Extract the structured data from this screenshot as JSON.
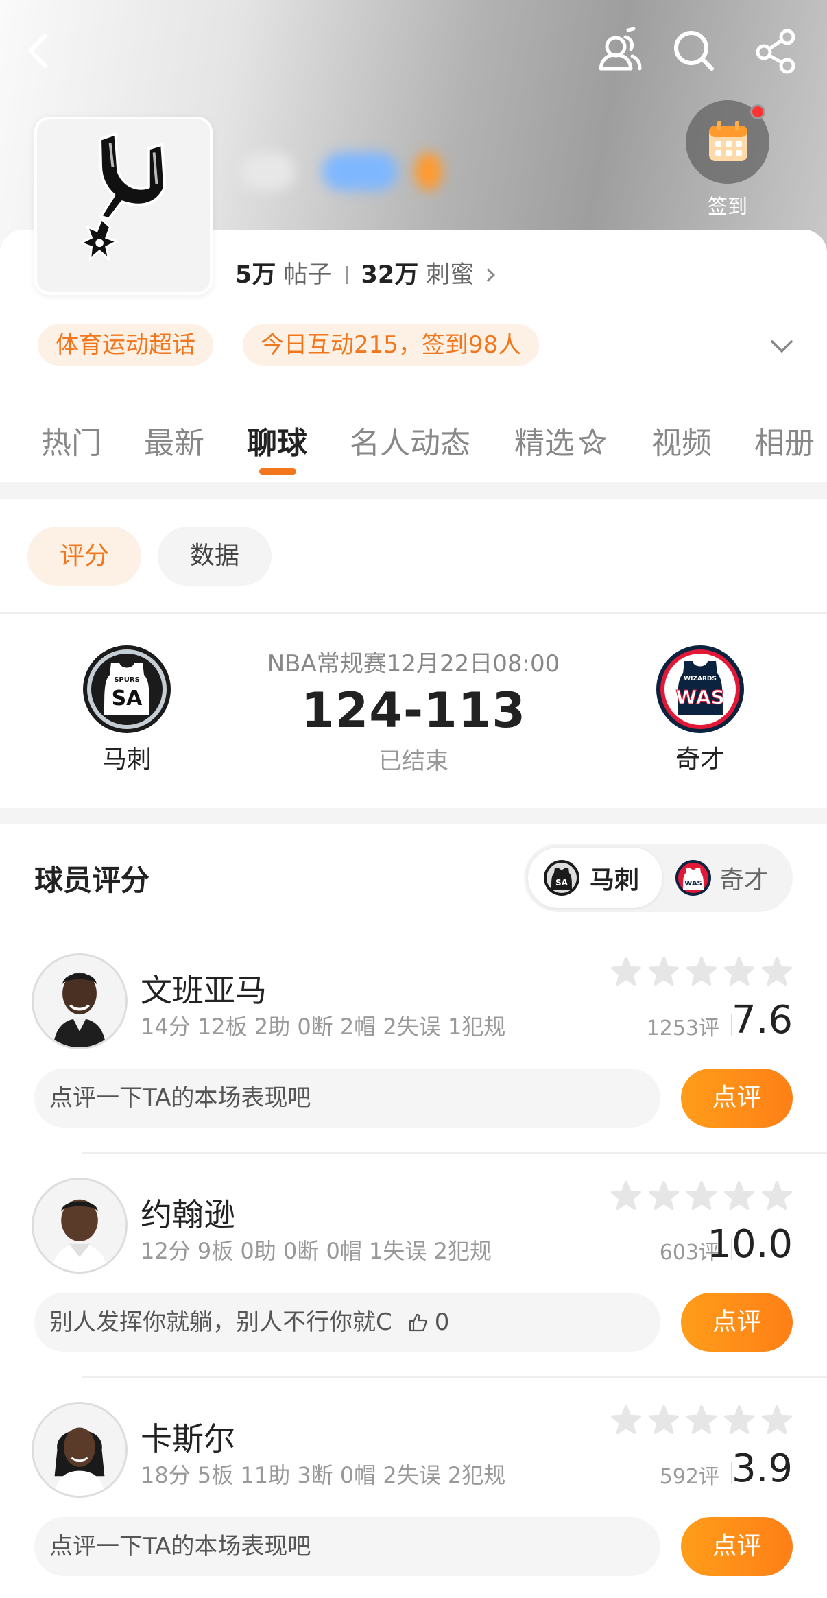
{
  "header": {
    "back_icon": "back-arrow-icon",
    "members_icon": "members-icon",
    "search_icon": "search-icon",
    "share_icon": "share-icon",
    "checkin_label": "签到"
  },
  "community": {
    "posts_count": "5万",
    "posts_label": "帖子",
    "fans_count": "32万",
    "fans_label": "刺蜜",
    "tags": [
      "体育运动超话",
      "今日互动215，签到98人"
    ]
  },
  "tabs": [
    {
      "label": "热门",
      "active": false
    },
    {
      "label": "最新",
      "active": false
    },
    {
      "label": "聊球",
      "active": true
    },
    {
      "label": "名人动态",
      "active": false
    },
    {
      "label": "精选",
      "active": false
    },
    {
      "label": "视频",
      "active": false
    },
    {
      "label": "相册",
      "active": false
    }
  ],
  "sub_tabs": {
    "rating": "评分",
    "data": "数据"
  },
  "game": {
    "info": "NBA常规赛12月22日08:00",
    "score": "124-113",
    "status": "已结束",
    "home": {
      "name": "马刺",
      "logo_text": "SA",
      "logo_sub": "SPURS"
    },
    "away": {
      "name": "奇才",
      "logo_text": "WAS",
      "logo_sub": "WIZARDS"
    }
  },
  "ratings_section": {
    "title": "球员评分",
    "toggle_home": "马刺",
    "toggle_away": "奇才"
  },
  "players": [
    {
      "name": "文班亚马",
      "stats": "14分 12板 2助 0断 2帽 2失误 1犯规",
      "rating_count": "1253评",
      "score": "7.6",
      "comment": "点评一下TA的本场表现吧",
      "likes": "",
      "button": "点评"
    },
    {
      "name": "约翰逊",
      "stats": "12分 9板 0助 0断 0帽 1失误 2犯规",
      "rating_count": "603评",
      "score": "10.0",
      "comment": "别人发挥你就躺，别人不行你就C",
      "likes": "0",
      "button": "点评"
    },
    {
      "name": "卡斯尔",
      "stats": "18分 5板 11助 3断 0帽 2失误 2犯规",
      "rating_count": "592评",
      "score": "3.9",
      "comment": "点评一下TA的本场表现吧",
      "likes": "",
      "button": "点评"
    }
  ],
  "colors": {
    "accent": "#f2771c",
    "tag_bg": "#fdf1e6",
    "button_orange": "#ff8c18"
  }
}
